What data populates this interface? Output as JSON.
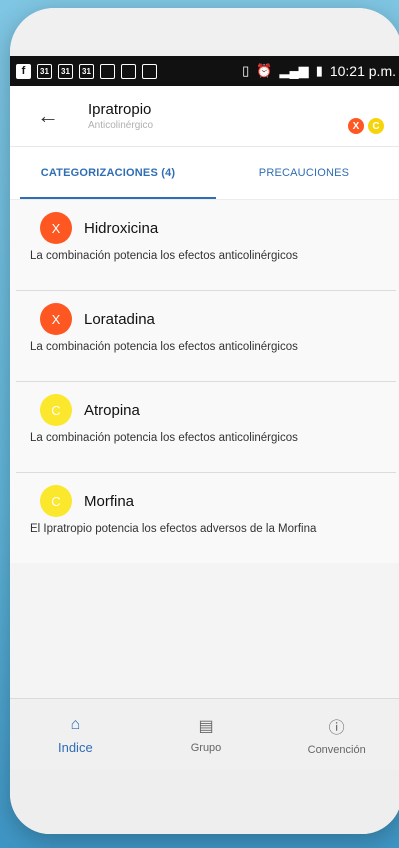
{
  "statusbar": {
    "left_icons": [
      "facebook-icon",
      "calendar-icon",
      "calendar-icon",
      "calendar-icon",
      "calendar-icon",
      "calendar-icon",
      "calendar-icon"
    ],
    "calendar_label": "31",
    "time": "10:21 p.m."
  },
  "appbar": {
    "title": "Ipratropio",
    "subtitle": "Anticolinérgico",
    "badges": [
      {
        "label": "X",
        "color": "#ff5722"
      },
      {
        "label": "C",
        "color": "#f6d40a"
      }
    ]
  },
  "tabs": [
    {
      "label": "CATEGORIZACIONES (4)",
      "active": true
    },
    {
      "label": "PRECAUCIONES",
      "active": false
    }
  ],
  "items": [
    {
      "letter": "X",
      "color": "#fe5722",
      "name": "Hidroxicina",
      "desc": "La combinación potencia los efectos anticolinérgicos"
    },
    {
      "letter": "X",
      "color": "#fe5722",
      "name": "Loratadina",
      "desc": "La combinación potencia los efectos anticolinérgicos"
    },
    {
      "letter": "C",
      "color": "#fbe72b",
      "name": "Atropina",
      "desc": "La combinación potencia los efectos anticolinérgicos"
    },
    {
      "letter": "C",
      "color": "#fbe72b",
      "name": "Morfina",
      "desc": "El Ipratropio potencia los efectos adversos de la Morfina"
    }
  ],
  "bottomnav": [
    {
      "label": "Indice",
      "icon": "home-icon",
      "active": true
    },
    {
      "label": "Grupo",
      "icon": "document-icon",
      "active": false
    },
    {
      "label": "Convención",
      "icon": "info-icon",
      "active": false
    }
  ],
  "colors": {
    "accent": "#2f6db4"
  }
}
